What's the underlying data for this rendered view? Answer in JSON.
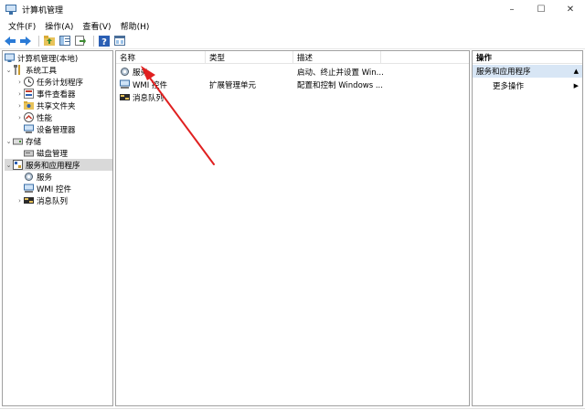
{
  "window": {
    "title": "计算机管理",
    "minimize": "–",
    "maximize": "☐",
    "close": "✕"
  },
  "menu": [
    "文件(F)",
    "操作(A)",
    "查看(V)",
    "帮助(H)"
  ],
  "toolbar": {
    "buttons": [
      "back-icon",
      "forward-icon",
      "up-folder-icon",
      "show-hide-tree-icon",
      "export-list-icon",
      "help-icon",
      "properties-icon"
    ]
  },
  "tree": {
    "items": [
      {
        "label": "计算机管理(本地)",
        "icon": "computer-icon",
        "twisty": ""
      },
      {
        "label": "系统工具",
        "icon": "tools-icon",
        "twisty": "⌄"
      },
      {
        "label": "任务计划程序",
        "icon": "clock-icon",
        "twisty": "›"
      },
      {
        "label": "事件查看器",
        "icon": "event-viewer-icon",
        "twisty": "›"
      },
      {
        "label": "共享文件夹",
        "icon": "shared-folder-icon",
        "twisty": "›"
      },
      {
        "label": "性能",
        "icon": "performance-icon",
        "twisty": "›"
      },
      {
        "label": "设备管理器",
        "icon": "device-manager-icon",
        "twisty": ""
      },
      {
        "label": "存储",
        "icon": "storage-icon",
        "twisty": "⌄"
      },
      {
        "label": "磁盘管理",
        "icon": "disk-icon",
        "twisty": ""
      },
      {
        "label": "服务和应用程序",
        "icon": "services-apps-icon",
        "twisty": "⌄"
      },
      {
        "label": "服务",
        "icon": "services-icon",
        "twisty": ""
      },
      {
        "label": "WMI 控件",
        "icon": "wmi-icon",
        "twisty": ""
      },
      {
        "label": "消息队列",
        "icon": "message-queue-icon",
        "twisty": "›"
      }
    ]
  },
  "list": {
    "columns": [
      "名称",
      "类型",
      "描述"
    ],
    "rows": [
      {
        "name": "服务",
        "type": "",
        "desc": "启动、终止并设置 Win...",
        "icon": "services-icon"
      },
      {
        "name": "WMI 控件",
        "type": "扩展管理单元",
        "desc": "配置和控制 Windows ...",
        "icon": "wmi-icon"
      },
      {
        "name": "消息队列",
        "type": "",
        "desc": "",
        "icon": "message-queue-icon"
      }
    ]
  },
  "actions": {
    "title": "操作",
    "section": "服务和应用程序",
    "section_arrow": "▲",
    "more": "更多操作",
    "more_arrow": "▶"
  },
  "colors": {
    "annotation_arrow": "#e02020",
    "selection": "#d9d9d9",
    "action_section": "#d8e6f5"
  }
}
